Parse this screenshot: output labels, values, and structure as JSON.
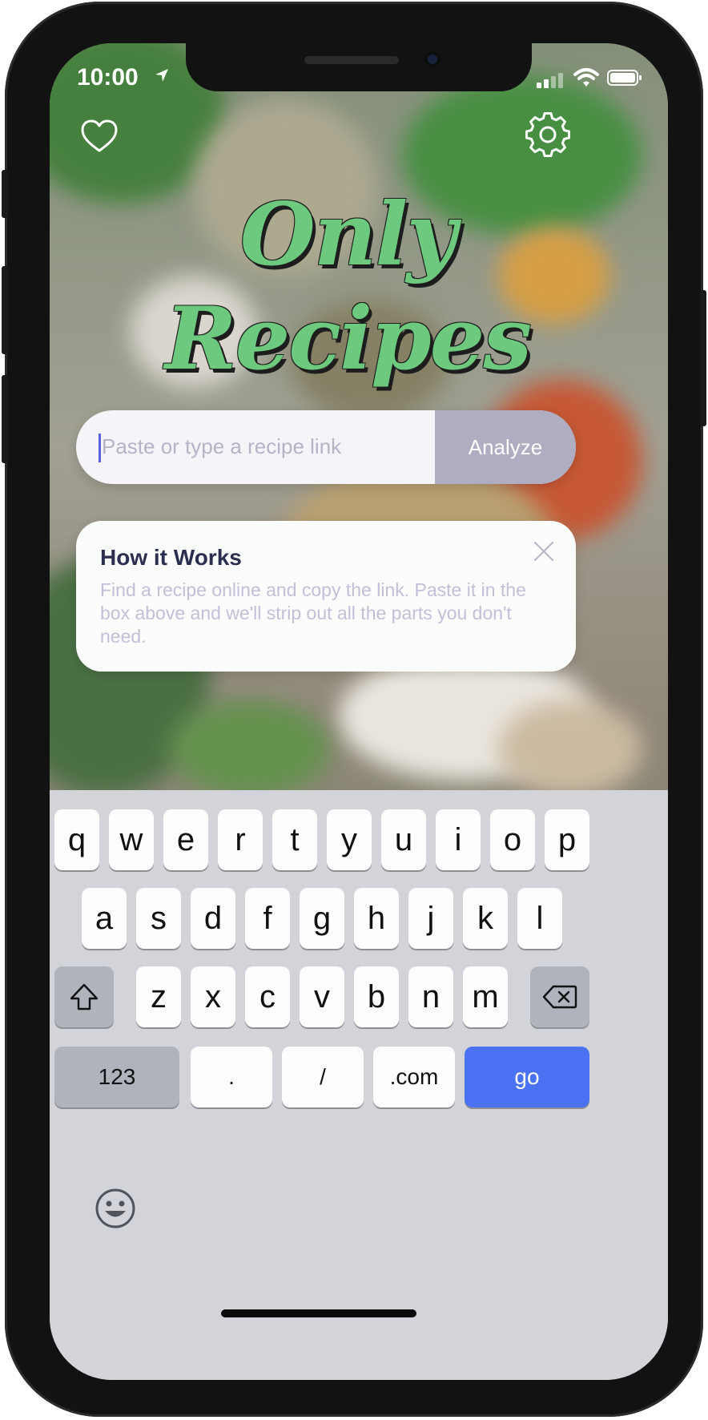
{
  "status_bar": {
    "time": "10:00"
  },
  "app": {
    "title": "Only Recipes"
  },
  "search": {
    "placeholder": "Paste or type a recipe link",
    "analyze_label": "Analyze"
  },
  "how_it_works": {
    "title": "How it Works",
    "body": "Find a recipe online and copy the link. Paste it in the box above and we'll strip out all the parts you don't need."
  },
  "keyboard": {
    "row1": [
      "q",
      "w",
      "e",
      "r",
      "t",
      "y",
      "u",
      "i",
      "o",
      "p"
    ],
    "row2": [
      "a",
      "s",
      "d",
      "f",
      "g",
      "h",
      "j",
      "k",
      "l"
    ],
    "row3": [
      "z",
      "x",
      "c",
      "v",
      "b",
      "n",
      "m"
    ],
    "bottom": {
      "numbers": "123",
      "dot": ".",
      "slash": "/",
      "dotcom": ".com",
      "go": "go"
    }
  },
  "colors": {
    "accent_go": "#4b72f3",
    "logo_green": "#6cc97e",
    "analyze_bg": "#aeadc1"
  },
  "icons": [
    "heart-icon",
    "gear-icon",
    "location-arrow-icon",
    "signal-icon",
    "wifi-icon",
    "battery-icon",
    "close-icon",
    "shift-icon",
    "backspace-icon",
    "emoji-icon"
  ]
}
